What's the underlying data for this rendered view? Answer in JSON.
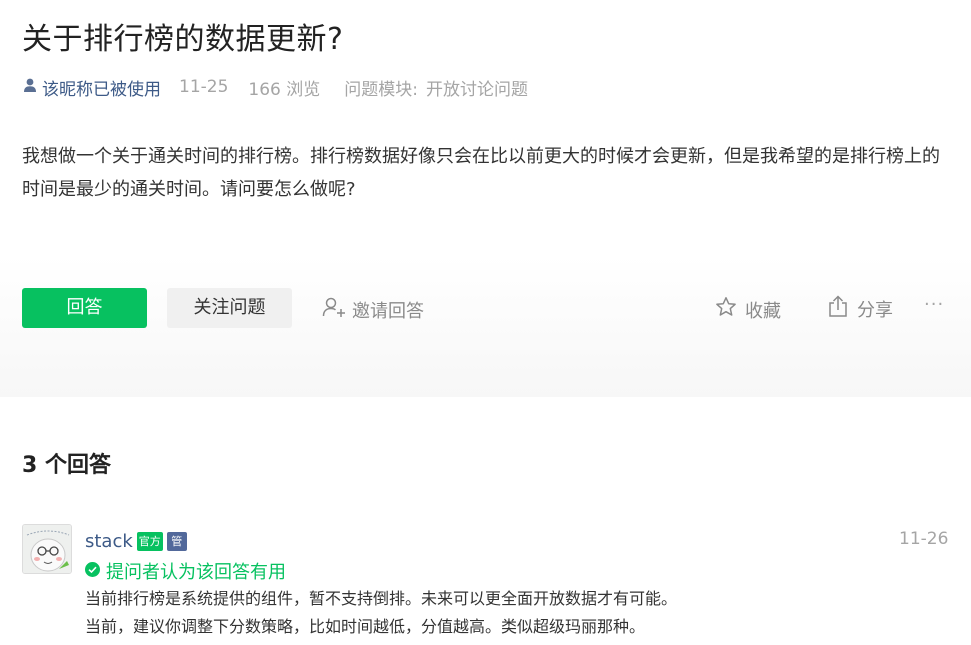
{
  "question": {
    "title": "关于排行榜的数据更新?",
    "author": "该昵称已被使用",
    "date": "11-25",
    "views": "166 浏览",
    "module_label": "问题模块:",
    "module": "开放讨论问题",
    "body": "我想做一个关于通关时间的排行榜。排行榜数据好像只会在比以前更大的时候才会更新，但是我希望的是排行榜上的时间是最少的通关时间。请问要怎么做呢?"
  },
  "actions": {
    "answer": "回答",
    "follow": "关注问题",
    "invite": "邀请回答",
    "favorite": "收藏",
    "share": "分享",
    "more": "···"
  },
  "answers": {
    "count_label": "3 个回答",
    "items": [
      {
        "author": "stack",
        "badge_official": "官方",
        "badge_admin": "管",
        "date": "11-26",
        "accepted": "提问者认为该回答有用",
        "line1": "当前排行榜是系统提供的组件，暂不支持倒排。未来可以更全面开放数据才有可能。",
        "line2": "当前，建议你调整下分数策略，比如时间越低，分值越高。类似超级玛丽那种。"
      }
    ]
  },
  "colors": {
    "accent": "#07c160",
    "link": "#3d5a87",
    "muted": "#a5a5a5"
  },
  "icons": [
    "user-icon",
    "invite-user-icon",
    "star-icon",
    "share-icon",
    "more-icon",
    "check-circle-icon"
  ]
}
